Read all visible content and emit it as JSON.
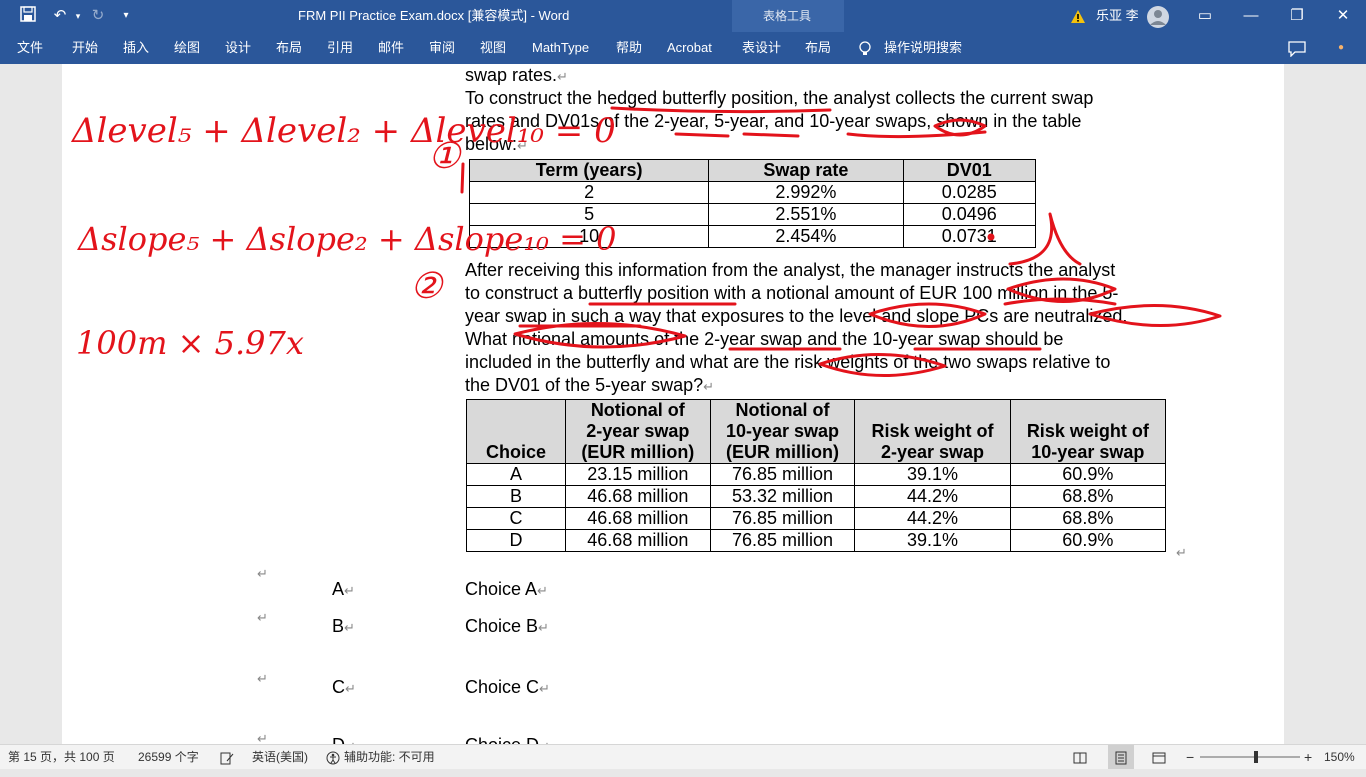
{
  "titlebar": {
    "title": "FRM PII Practice Exam.docx [兼容模式]  -  Word",
    "context_tab": "表格工具",
    "user": "乐亚 李"
  },
  "ribbon": {
    "tabs": [
      "文件",
      "开始",
      "插入",
      "绘图",
      "设计",
      "布局",
      "引用",
      "邮件",
      "审阅",
      "视图",
      "MathType",
      "帮助",
      "Acrobat",
      "表设计",
      "布局"
    ],
    "tell_me": "操作说明搜索"
  },
  "document": {
    "line_swap_rates": "swap rates.",
    "intro_lines": [
      "To construct the hedged butterfly position, the analyst collects the current swap",
      "rates and DV01s of the 2-year, 5-year, and 10-year swaps, shown in the table",
      "below:"
    ],
    "table1": {
      "headers": [
        "Term (years)",
        "Swap rate",
        "DV01"
      ],
      "rows": [
        [
          "2",
          "2.992%",
          "0.0285"
        ],
        [
          "5",
          "2.551%",
          "0.0496"
        ],
        [
          "10",
          "2.454%",
          "0.0731"
        ]
      ]
    },
    "question_lines": [
      "After receiving this information from the analyst, the manager instructs the analyst",
      "to construct a butterfly position with a notional amount of EUR 100 million in the 5-",
      "year swap in such a way that exposures to the level and slope PCs are neutralized.",
      "What notional amounts of the 2-year swap and the 10-year swap should be",
      "included in the butterfly and what are the risk weights of the two swaps relative to",
      "the DV01 of the 5-year swap?"
    ],
    "table2": {
      "headers": [
        [
          "Choice"
        ],
        [
          "Notional of",
          "2-year swap",
          "(EUR million)"
        ],
        [
          "Notional of",
          "10-year swap",
          "(EUR million)"
        ],
        [
          "Risk weight of",
          "2-year swap"
        ],
        [
          "Risk weight of",
          "10-year swap"
        ]
      ],
      "rows": [
        [
          "A",
          "23.15 million",
          "76.85 million",
          "39.1%",
          "60.9%"
        ],
        [
          "B",
          "46.68 million",
          "53.32 million",
          "44.2%",
          "68.8%"
        ],
        [
          "C",
          "46.68 million",
          "76.85 million",
          "44.2%",
          "68.8%"
        ],
        [
          "D",
          "46.68 million",
          "76.85 million",
          "39.1%",
          "60.9%"
        ]
      ]
    },
    "choices": [
      {
        "letter": "A",
        "text": "Choice A"
      },
      {
        "letter": "B",
        "text": "Choice B"
      },
      {
        "letter": "C",
        "text": "Choice C"
      },
      {
        "letter": "D",
        "text": "Choice D"
      }
    ],
    "paragraph_mark": "↵"
  },
  "annotations": {
    "line1": "Δlevel₅ + Δlevel₂ + Δlevel₁₀ = 0",
    "mark1": "①",
    "line2": "Δslope₅ + Δslope₂ + Δslope₁₀ = 0",
    "mark2": "②",
    "line3": "100m × 5.97x"
  },
  "statusbar": {
    "page": "第 15 页，共 100 页",
    "words": "26599 个字",
    "language": "英语(美国)",
    "accessibility": "辅助功能: 不可用",
    "zoom": "150%"
  },
  "colors": {
    "titlebar": "#2b579a",
    "ink": "#e3131b"
  }
}
